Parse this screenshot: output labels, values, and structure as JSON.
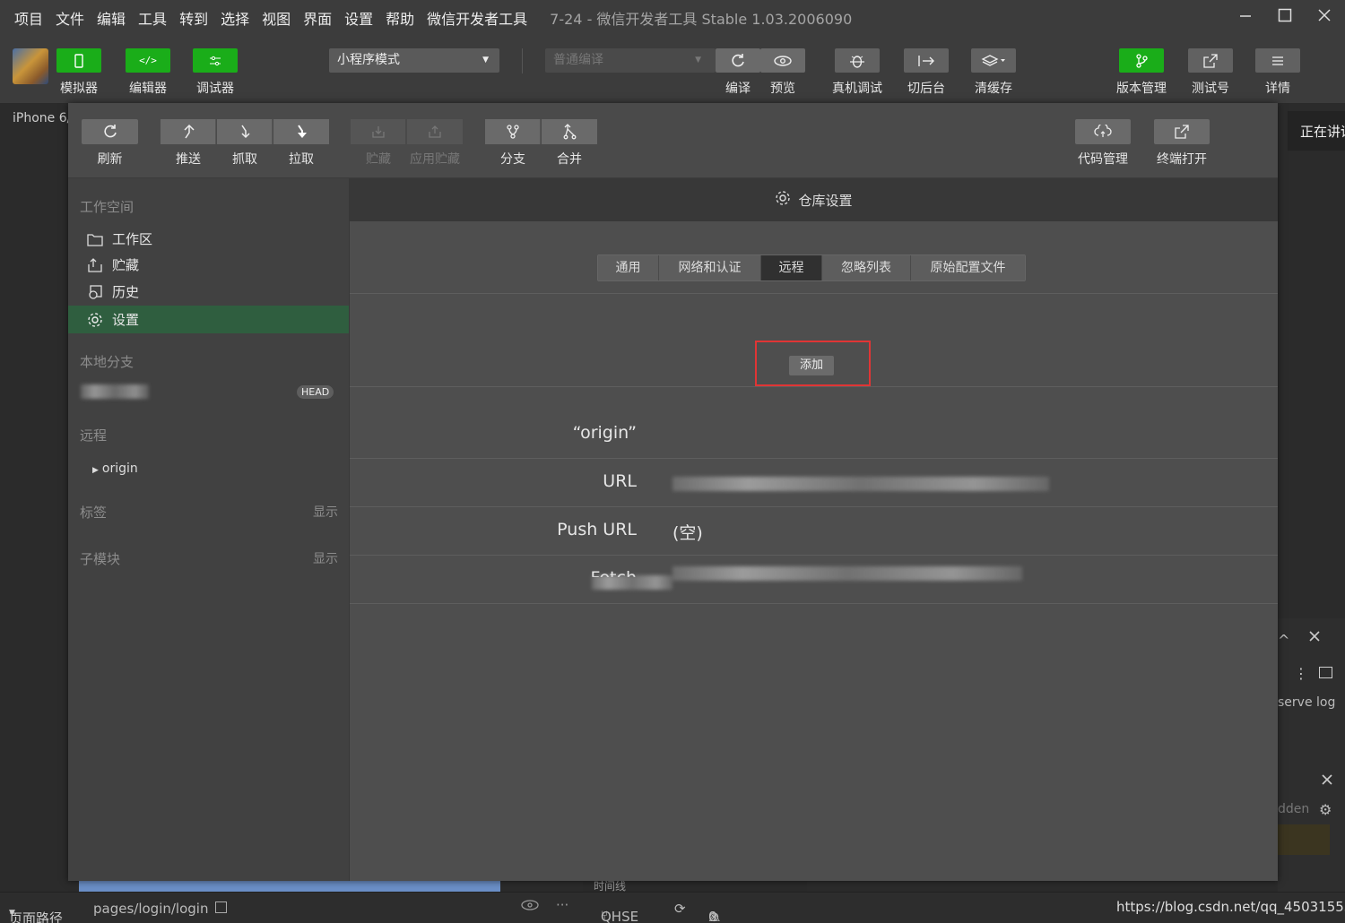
{
  "menubar": {
    "items": [
      "项目",
      "文件",
      "编辑",
      "工具",
      "转到",
      "选择",
      "视图",
      "界面",
      "设置",
      "帮助",
      "微信开发者工具"
    ],
    "window_title": "7-24 - 微信开发者工具 Stable 1.03.2006090"
  },
  "toolbar": {
    "simulator": "模拟器",
    "editor": "编辑器",
    "debugger": "调试器",
    "mode": "小程序模式",
    "compile_mode": "普通编译",
    "compile": "编译",
    "preview": "预览",
    "real_debug": "真机调试",
    "background": "切后台",
    "clear_cache": "清缓存",
    "version": "版本管理",
    "test_account": "测试号",
    "details": "详情"
  },
  "background": {
    "device": "iPhone 6/",
    "right_label": "正在讲话",
    "preserve_log": "serve log",
    "hidden": "dden"
  },
  "dialog": {
    "toolbar": {
      "refresh": "刷新",
      "push": "推送",
      "fetch": "抓取",
      "pull": "拉取",
      "stash": "贮藏",
      "apply_stash": "应用贮藏",
      "branch": "分支",
      "merge": "合并",
      "code_mgmt": "代码管理",
      "terminal": "终端打开"
    },
    "sidebar": {
      "workspace_title": "工作空间",
      "workspace_items": [
        "工作区",
        "贮藏",
        "历史",
        "设置"
      ],
      "local_branch_title": "本地分支",
      "head_badge": "HEAD",
      "remote_title": "远程",
      "remote_item": "origin",
      "tags_title": "标签",
      "submodule_title": "子模块",
      "show": "显示"
    },
    "main": {
      "title": "仓库设置",
      "tabs": [
        "通用",
        "网络和认证",
        "远程",
        "忽略列表",
        "原始配置文件"
      ],
      "active_tab": "远程",
      "add_button": "添加",
      "remote_name": "“origin”",
      "url_label": "URL",
      "push_url_label": "Push URL",
      "push_url_value": "(空)",
      "fetch_label": "Fetch"
    }
  },
  "statusbar": {
    "page_path_label": "页面路径",
    "page_path": "pages/login/login",
    "branch": "QHSE",
    "errors": "0",
    "warnings": "0",
    "timeline": "时间线"
  },
  "watermark": "https://blog.csdn.net/qq_45031555"
}
